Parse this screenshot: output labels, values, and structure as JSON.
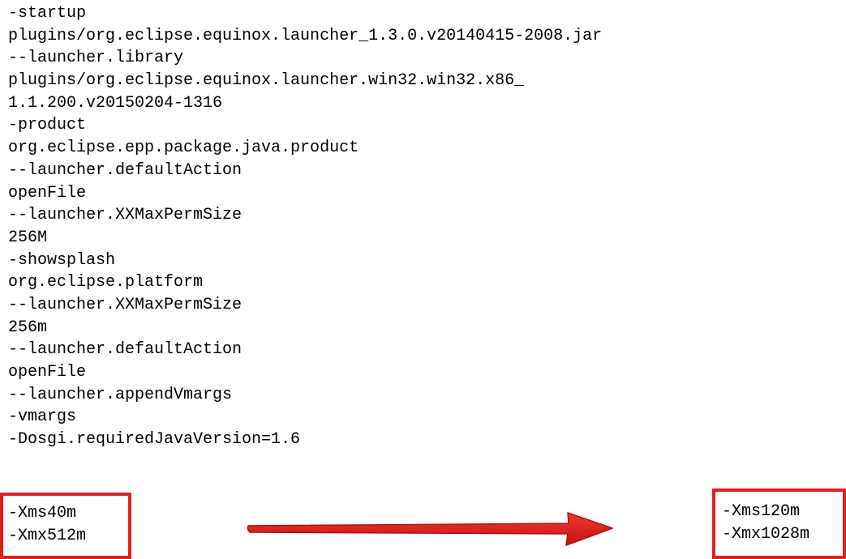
{
  "config_lines": [
    "-startup",
    "plugins/org.eclipse.equinox.launcher_1.3.0.v20140415-2008.jar",
    "--launcher.library",
    "plugins/org.eclipse.equinox.launcher.win32.win32.x86_",
    "1.1.200.v20150204-1316",
    "-product",
    "org.eclipse.epp.package.java.product",
    "--launcher.defaultAction",
    "openFile",
    "--launcher.XXMaxPermSize",
    "256M",
    "-showsplash",
    "org.eclipse.platform",
    "--launcher.XXMaxPermSize",
    "256m",
    "--launcher.defaultAction",
    "openFile",
    "--launcher.appendVmargs",
    "-vmargs",
    "-Dosgi.requiredJavaVersion=1.6"
  ],
  "before": {
    "xms": "-Xms40m",
    "xmx": "-Xmx512m"
  },
  "after": {
    "xms": "-Xms120m",
    "xmx": "-Xmx1028m"
  },
  "colors": {
    "highlight": "#e0201c",
    "text": "#000000",
    "background": "#ffffff"
  },
  "icons": {
    "arrow": "right-arrow-icon"
  }
}
